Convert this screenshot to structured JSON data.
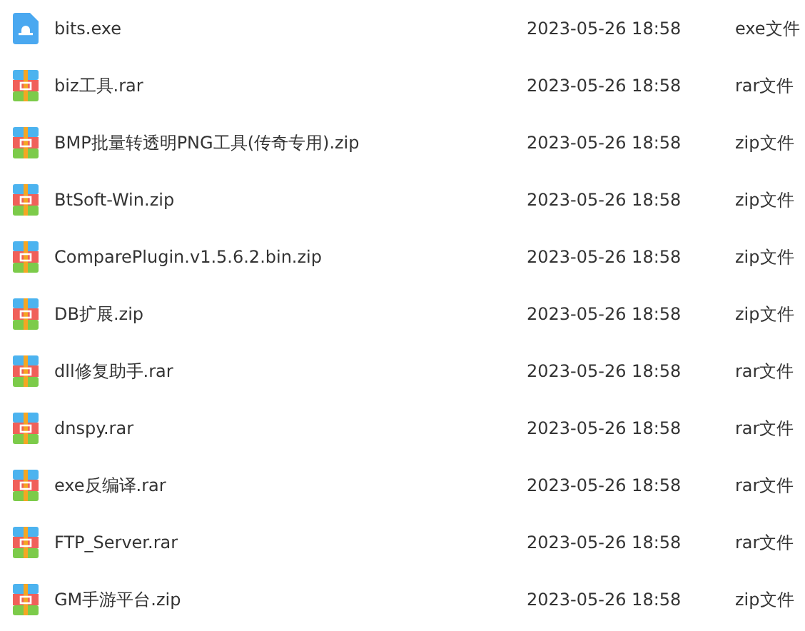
{
  "files": [
    {
      "kind": "exe",
      "name": "bits.exe",
      "modified": "2023-05-26 18:58",
      "type": "exe文件"
    },
    {
      "kind": "archive",
      "name": "biz工具.rar",
      "modified": "2023-05-26 18:58",
      "type": "rar文件"
    },
    {
      "kind": "archive",
      "name": "BMP批量转透明PNG工具(传奇专用).zip",
      "modified": "2023-05-26 18:58",
      "type": "zip文件"
    },
    {
      "kind": "archive",
      "name": "BtSoft-Win.zip",
      "modified": "2023-05-26 18:58",
      "type": "zip文件"
    },
    {
      "kind": "archive",
      "name": "ComparePlugin.v1.5.6.2.bin.zip",
      "modified": "2023-05-26 18:58",
      "type": "zip文件"
    },
    {
      "kind": "archive",
      "name": "DB扩展.zip",
      "modified": "2023-05-26 18:58",
      "type": "zip文件"
    },
    {
      "kind": "archive",
      "name": "dll修复助手.rar",
      "modified": "2023-05-26 18:58",
      "type": "rar文件"
    },
    {
      "kind": "archive",
      "name": "dnspy.rar",
      "modified": "2023-05-26 18:58",
      "type": "rar文件"
    },
    {
      "kind": "archive",
      "name": "exe反编译.rar",
      "modified": "2023-05-26 18:58",
      "type": "rar文件"
    },
    {
      "kind": "archive",
      "name": "FTP_Server.rar",
      "modified": "2023-05-26 18:58",
      "type": "rar文件"
    },
    {
      "kind": "archive",
      "name": "GM手游平台.zip",
      "modified": "2023-05-26 18:58",
      "type": "zip文件"
    }
  ]
}
